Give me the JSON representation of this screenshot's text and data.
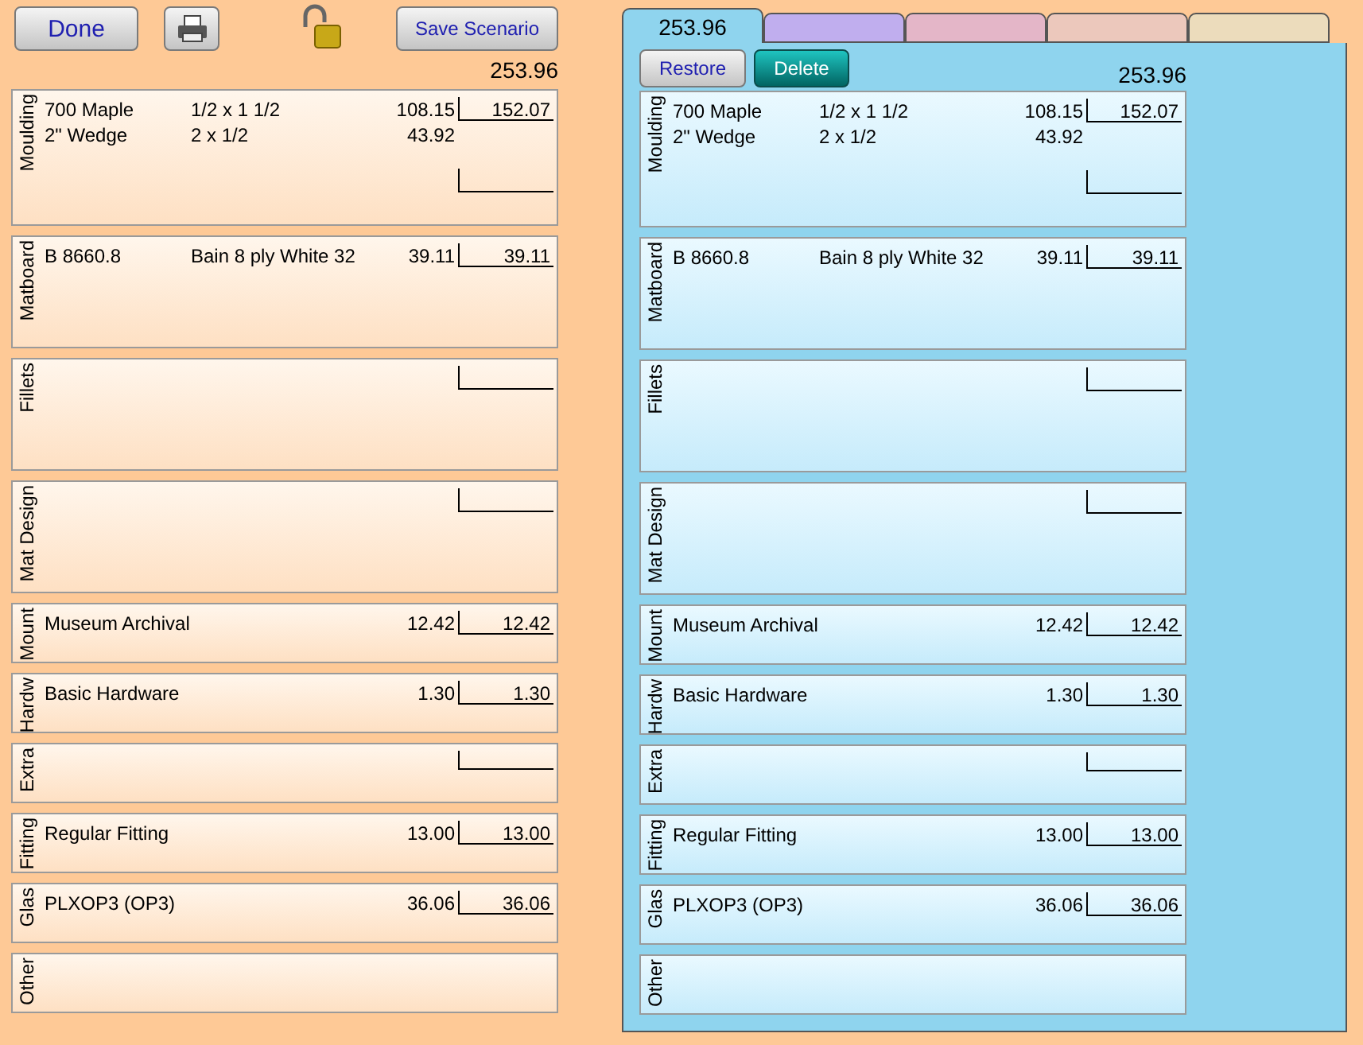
{
  "toolbar": {
    "done_button": "Done",
    "save_button": "Save Scenario",
    "locked": false
  },
  "current": {
    "total": "253.96",
    "sections": [
      {
        "label": "Moulding",
        "kind": "large",
        "total_box": true,
        "extra_box": true,
        "total": "152.07",
        "lines": [
          {
            "item": "700 Maple",
            "dimensions": "1/2 x 1 1/2",
            "price": "108.15"
          },
          {
            "item": "2\" Wedge",
            "dimensions": "2 x 1/2",
            "price": "43.92"
          }
        ]
      },
      {
        "label": "Matboard",
        "kind": "medium",
        "total_box": true,
        "extra_box": false,
        "total": "39.11",
        "lines": [
          {
            "item": "B 8660.8",
            "dimensions": "Bain 8 ply White 32",
            "price": "39.11"
          }
        ]
      },
      {
        "label": "Fillets",
        "kind": "medium",
        "total_box": true,
        "extra_box": false
      },
      {
        "label": "Mat Design",
        "kind": "medium",
        "total_box": true,
        "extra_box": false
      },
      {
        "label": "Mount",
        "kind": "small",
        "total_box": true,
        "extra_box": false,
        "total": "12.42",
        "lines": [
          {
            "item": "Museum Archival",
            "price": "12.42"
          }
        ]
      },
      {
        "label": "Hardw",
        "kind": "small",
        "total_box": true,
        "extra_box": false,
        "total": "1.30",
        "lines": [
          {
            "item": "Basic Hardware",
            "price": "1.30"
          }
        ]
      },
      {
        "label": "Extra",
        "kind": "small",
        "total_box": true,
        "extra_box": false
      },
      {
        "label": "Fitting",
        "kind": "small",
        "total_box": true,
        "extra_box": false,
        "total": "13.00",
        "lines": [
          {
            "item": "Regular Fitting",
            "price": "13.00"
          }
        ]
      },
      {
        "label": "Glas",
        "kind": "small",
        "total_box": true,
        "extra_box": false,
        "total": "36.06",
        "lines": [
          {
            "item": "PLXOP3 (OP3)",
            "price": "36.06"
          }
        ]
      },
      {
        "label": "Other",
        "kind": "small",
        "total_box": false,
        "extra_box": false
      }
    ]
  },
  "scenarios": {
    "tabs": [
      {
        "label": "253.96",
        "selected": true,
        "color": "#8fd4ee"
      },
      {
        "selected": false,
        "color": "#c0aeee"
      },
      {
        "selected": false,
        "color": "#e4b6c8"
      },
      {
        "selected": false,
        "color": "#ecc8bc"
      },
      {
        "selected": false,
        "color": "#ecdcbc"
      }
    ],
    "restore_button": "Restore",
    "delete_button": "Delete",
    "total": "253.96",
    "sections": [
      {
        "label": "Moulding",
        "kind": "large",
        "total_box": true,
        "extra_box": true,
        "total": "152.07",
        "lines": [
          {
            "item": "700 Maple",
            "dimensions": "1/2 x 1 1/2",
            "price": "108.15"
          },
          {
            "item": "2\" Wedge",
            "dimensions": "2 x 1/2",
            "price": "43.92"
          }
        ]
      },
      {
        "label": "Matboard",
        "kind": "medium",
        "total_box": true,
        "extra_box": false,
        "total": "39.11",
        "lines": [
          {
            "item": "B 8660.8",
            "dimensions": "Bain 8 ply White 32",
            "price": "39.11"
          }
        ]
      },
      {
        "label": "Fillets",
        "kind": "medium",
        "total_box": true,
        "extra_box": false
      },
      {
        "label": "Mat Design",
        "kind": "medium",
        "total_box": true,
        "extra_box": false
      },
      {
        "label": "Mount",
        "kind": "small",
        "total_box": true,
        "extra_box": false,
        "total": "12.42",
        "lines": [
          {
            "item": "Museum Archival",
            "price": "12.42"
          }
        ]
      },
      {
        "label": "Hardw",
        "kind": "small",
        "total_box": true,
        "extra_box": false,
        "total": "1.30",
        "lines": [
          {
            "item": "Basic Hardware",
            "price": "1.30"
          }
        ]
      },
      {
        "label": "Extra",
        "kind": "small",
        "total_box": true,
        "extra_box": false
      },
      {
        "label": "Fitting",
        "kind": "small",
        "total_box": true,
        "extra_box": false,
        "total": "13.00",
        "lines": [
          {
            "item": "Regular Fitting",
            "price": "13.00"
          }
        ]
      },
      {
        "label": "Glas",
        "kind": "small",
        "total_box": true,
        "extra_box": false,
        "total": "36.06",
        "lines": [
          {
            "item": "PLXOP3 (OP3)",
            "price": "36.06"
          }
        ]
      },
      {
        "label": "Other",
        "kind": "small",
        "total_box": false,
        "extra_box": false
      }
    ]
  }
}
